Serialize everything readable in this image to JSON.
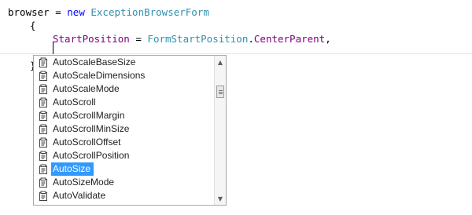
{
  "code": {
    "line1": {
      "var": "browser",
      "op": " = ",
      "kw": "new",
      "type": "ExceptionBrowserForm"
    },
    "line2": {
      "brace": "{"
    },
    "line3": {
      "prop": "StartPosition",
      "op": " = ",
      "type": "FormStartPosition",
      "dot": ".",
      "member": "CenterParent",
      "comma": ","
    },
    "line5": {
      "brace": "}"
    }
  },
  "completion": {
    "items": [
      {
        "label": "AutoScaleBaseSize",
        "icon": "property-icon"
      },
      {
        "label": "AutoScaleDimensions",
        "icon": "property-icon"
      },
      {
        "label": "AutoScaleMode",
        "icon": "property-icon"
      },
      {
        "label": "AutoScroll",
        "icon": "property-icon"
      },
      {
        "label": "AutoScrollMargin",
        "icon": "property-icon"
      },
      {
        "label": "AutoScrollMinSize",
        "icon": "property-icon"
      },
      {
        "label": "AutoScrollOffset",
        "icon": "property-icon"
      },
      {
        "label": "AutoScrollPosition",
        "icon": "property-icon"
      },
      {
        "label": "AutoSize",
        "icon": "property-icon"
      },
      {
        "label": "AutoSizeMode",
        "icon": "property-icon"
      },
      {
        "label": "AutoValidate",
        "icon": "property-icon"
      }
    ],
    "selected_index": 8,
    "colors": {
      "selection": "#3399ff",
      "border": "#a9a9a9"
    }
  },
  "scrollbar": {
    "up_arrow": "▲",
    "down_arrow": "▼"
  }
}
